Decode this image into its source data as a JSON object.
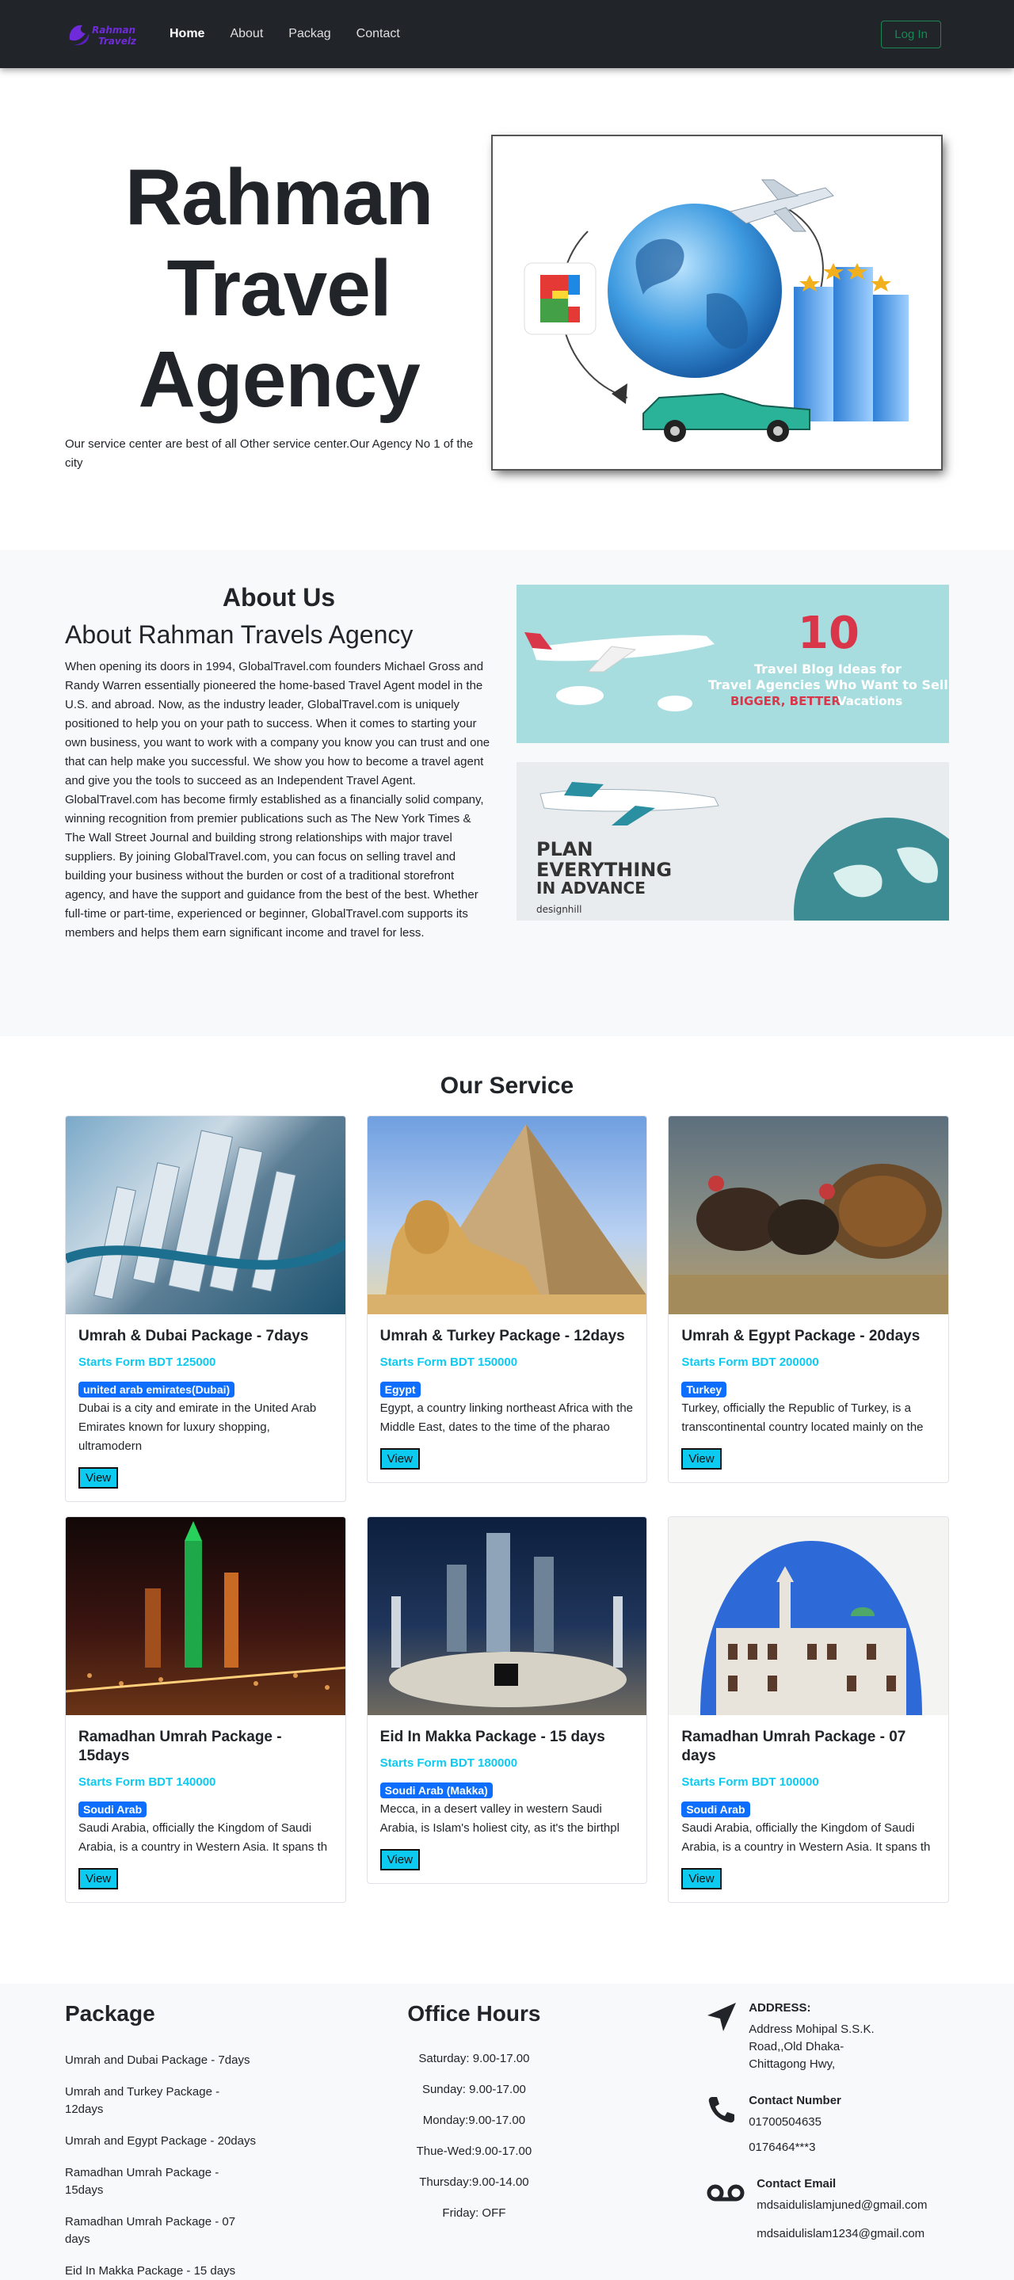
{
  "nav": {
    "logo_line1": "Rahman",
    "logo_line2": "Travelz",
    "links": [
      "Home",
      "About",
      "Packag",
      "Contact"
    ],
    "login": "Log In"
  },
  "hero": {
    "title_line1": "Rahman",
    "title_line2": "Travel",
    "title_line3": "Agency",
    "subtitle": "Our service center are best of all Other service center.Our Agency No 1 of the city"
  },
  "about": {
    "heading": "About Us",
    "subheading": "About Rahman Travels Agency",
    "paragraph1": "When opening its doors in 1994, GlobalTravel.com founders Michael Gross and Randy Warren essentially pioneered the home-based Travel Agent model in the U.S. and abroad. Now, as the industry leader, GlobalTravel.com is uniquely positioned to help you on your path to success. When it comes to starting your own business, you want to work with a company you know you can trust and one that can help make you successful. We show you how to become a travel agent and give you the tools to succeed as an Independent Travel Agent.",
    "paragraph2": "GlobalTravel.com has become firmly established as a financially solid company, winning recognition from premier publications such as The New York Times & The Wall Street Journal and building strong relationships with major travel suppliers. By joining GlobalTravel.com, you can focus on selling travel and building your business without the burden or cost of a traditional storefront agency, and have the support and guidance from the best of the best. Whether full-time or part-time, experienced or beginner, GlobalTravel.com supports its members and helps them earn significant income and travel for less.",
    "img1": {
      "big": "10",
      "line1": "Travel Blog Ideas for",
      "line2": "Travel Agencies Who Want to Sell",
      "line3a": "BIGGER, BETTER",
      "line3b": " Vacations"
    },
    "img2": {
      "line1": "PLAN",
      "line2": "EVERYTHING",
      "line3": "IN ADVANCE",
      "brand": "designhill"
    }
  },
  "services": {
    "title": "Our Service",
    "cards": [
      {
        "title": "Umrah & Dubai Package - 7days",
        "price": "Starts Form BDT 125000",
        "badge": "united arab emirates(Dubai)",
        "desc": "Dubai is a city and emirate in the United Arab Emirates known for luxury shopping, ultramodern",
        "button": "View"
      },
      {
        "title": "Umrah & Turkey Package - 12days",
        "price": "Starts Form BDT 150000",
        "badge": "Egypt",
        "desc": "Egypt, a country linking northeast Africa with the Middle East, dates to the time of the pharao",
        "button": "View"
      },
      {
        "title": "Umrah & Egypt Package - 20days",
        "price": "Starts Form BDT 200000",
        "badge": "Turkey",
        "desc": "Turkey, officially the Republic of Turkey, is a transcontinental country located mainly on the",
        "button": "View"
      },
      {
        "title": "Ramadhan Umrah Package - 15days",
        "price": "Starts Form BDT 140000",
        "badge": "Soudi Arab",
        "desc": "Saudi Arabia, officially the Kingdom of Saudi Arabia, is a country in Western Asia. It spans th",
        "button": "View"
      },
      {
        "title": "Eid In Makka Package - 15 days",
        "price": "Starts Form BDT 180000",
        "badge": "Soudi Arab (Makka)",
        "desc": "Mecca, in a desert valley in western Saudi Arabia, is Islam's holiest city, as it's the birthpl",
        "button": "View"
      },
      {
        "title": "Ramadhan Umrah Package - 07 days",
        "price": "Starts Form BDT 100000",
        "badge": "Soudi Arab",
        "desc": "Saudi Arabia, officially the Kingdom of Saudi Arabia, is a country in Western Asia. It spans th",
        "button": "View"
      }
    ]
  },
  "footer": {
    "package_title": "Package",
    "packages": [
      "Umrah and Dubai Package - 7days",
      "Umrah and Turkey Package - 12days",
      "Umrah and Egypt Package - 20days",
      "Ramadhan Umrah Package - 15days",
      "Ramadhan Umrah Package - 07 days",
      "Eid In Makka Package - 15 days"
    ],
    "hours_title": "Office Hours",
    "hours": [
      "Saturday: 9.00-17.00",
      "Sunday: 9.00-17.00",
      "Monday:9.00-17.00",
      "Thue-Wed:9.00-17.00",
      "Thursday:9.00-14.00",
      "Friday: OFF"
    ],
    "address_label": "ADDRESS:",
    "address": "Address Mohipal S.S.K. Road,,Old Dhaka-Chittagong Hwy,",
    "phone_label": "Contact Number",
    "phones": [
      "01700504635",
      "0176464***3"
    ],
    "email_label": "Contact Email",
    "emails": [
      "mdsaidulislamjuned@gmail.com",
      "mdsaidulislam1234@gmail.com"
    ]
  }
}
